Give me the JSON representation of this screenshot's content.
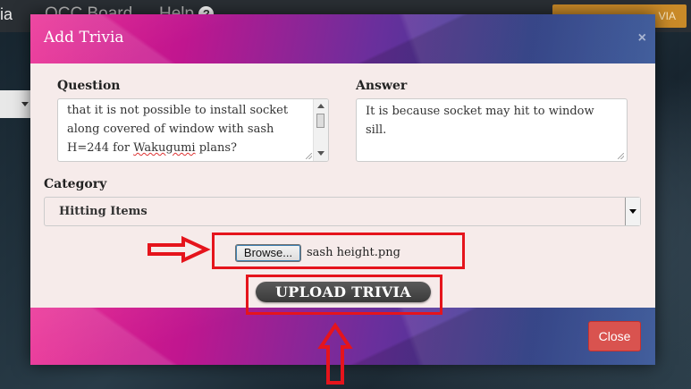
{
  "background": {
    "nav_brand": "ia",
    "nav_board": "QCC Board",
    "nav_help": "Help",
    "nav_help_icon": "?",
    "nav_button": "VIA"
  },
  "modal": {
    "title": "Add Trivia",
    "close_icon": "×",
    "question": {
      "label": "Question",
      "lines": [
        "that it is not possible to install socket",
        "along covered of window with sash",
        "H=244 for ",
        "Wakugumi",
        " plans?"
      ]
    },
    "answer": {
      "label": "Answer",
      "value": "It is because socket may hit to window sill."
    },
    "category": {
      "label": "Category",
      "selected": "Hitting Items"
    },
    "file": {
      "browse_label": "Browse...",
      "file_name": "sash height.png"
    },
    "upload_label": "UPLOAD TRIVIA",
    "close_label": "Close"
  },
  "annotations": {
    "color": "#e5141c"
  }
}
